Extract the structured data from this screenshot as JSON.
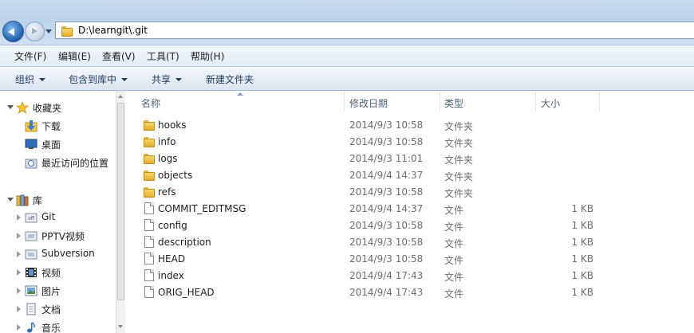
{
  "address": {
    "path": "D:\\learngit\\.git"
  },
  "menu": [
    "文件(F)",
    "编辑(E)",
    "查看(V)",
    "工具(T)",
    "帮助(H)"
  ],
  "commands": [
    {
      "label": "组织",
      "dropdown": true
    },
    {
      "label": "包含到库中",
      "dropdown": true
    },
    {
      "label": "共享",
      "dropdown": true
    },
    {
      "label": "新建文件夹",
      "dropdown": false
    }
  ],
  "nav": {
    "favorites": {
      "label": "收藏夹",
      "icon": "star-icon"
    },
    "favorite_items": [
      {
        "label": "下载",
        "icon": "downloads-icon"
      },
      {
        "label": "桌面",
        "icon": "desktop-icon"
      },
      {
        "label": "最近访问的位置",
        "icon": "recent-places-icon"
      }
    ],
    "libraries": {
      "label": "库",
      "icon": "library-icon"
    },
    "library_items": [
      {
        "label": "Git",
        "icon": "git-library-icon"
      },
      {
        "label": "PPTV视频",
        "icon": "pptv-library-icon"
      },
      {
        "label": "Subversion",
        "icon": "svn-library-icon"
      },
      {
        "label": "视频",
        "icon": "video-library-icon"
      },
      {
        "label": "图片",
        "icon": "pictures-library-icon"
      },
      {
        "label": "文档",
        "icon": "documents-library-icon"
      },
      {
        "label": "音乐",
        "icon": "music-library-icon"
      }
    ]
  },
  "columns": {
    "name": "名称",
    "date": "修改日期",
    "type": "类型",
    "size": "大小"
  },
  "files": [
    {
      "name": "hooks",
      "date": "2014/9/3 10:58",
      "type": "文件夹",
      "size": "",
      "kind": "folder"
    },
    {
      "name": "info",
      "date": "2014/9/3 10:58",
      "type": "文件夹",
      "size": "",
      "kind": "folder"
    },
    {
      "name": "logs",
      "date": "2014/9/3 11:01",
      "type": "文件夹",
      "size": "",
      "kind": "folder"
    },
    {
      "name": "objects",
      "date": "2014/9/4 14:37",
      "type": "文件夹",
      "size": "",
      "kind": "folder"
    },
    {
      "name": "refs",
      "date": "2014/9/3 10:58",
      "type": "文件夹",
      "size": "",
      "kind": "folder"
    },
    {
      "name": "COMMIT_EDITMSG",
      "date": "2014/9/4 14:37",
      "type": "文件",
      "size": "1 KB",
      "kind": "file"
    },
    {
      "name": "config",
      "date": "2014/9/3 10:58",
      "type": "文件",
      "size": "1 KB",
      "kind": "file"
    },
    {
      "name": "description",
      "date": "2014/9/3 10:58",
      "type": "文件",
      "size": "1 KB",
      "kind": "file"
    },
    {
      "name": "HEAD",
      "date": "2014/9/3 10:58",
      "type": "文件",
      "size": "1 KB",
      "kind": "file"
    },
    {
      "name": "index",
      "date": "2014/9/4 17:43",
      "type": "文件",
      "size": "1 KB",
      "kind": "file"
    },
    {
      "name": "ORIG_HEAD",
      "date": "2014/9/4 17:43",
      "type": "文件",
      "size": "1 KB",
      "kind": "file"
    }
  ]
}
